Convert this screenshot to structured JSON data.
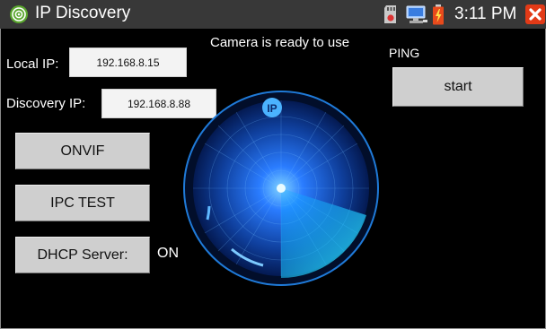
{
  "window": {
    "title": "IP Discovery",
    "close_icon": "close-icon"
  },
  "statusbar": {
    "time": "3:11 PM",
    "icons": [
      "sd-card-icon",
      "network-icon",
      "battery-icon"
    ]
  },
  "form": {
    "local_ip_label": "Local IP:",
    "local_ip_value": "192.168.8.15",
    "discovery_ip_label": "Discovery IP:",
    "discovery_ip_value": "192.168.8.88"
  },
  "status_message": "Camera is ready to use",
  "buttons": {
    "onvif": "ONVIF",
    "ipc_test": "IPC TEST",
    "dhcp_server": "DHCP Server:"
  },
  "dhcp_state": "ON",
  "ping": {
    "label": "PING",
    "start": "start"
  },
  "radar": {
    "badge": "IP"
  },
  "colors": {
    "radar_accent": "#2aa6ff",
    "statusbar_bg": "#383838",
    "close_bg": "#e23a17"
  }
}
